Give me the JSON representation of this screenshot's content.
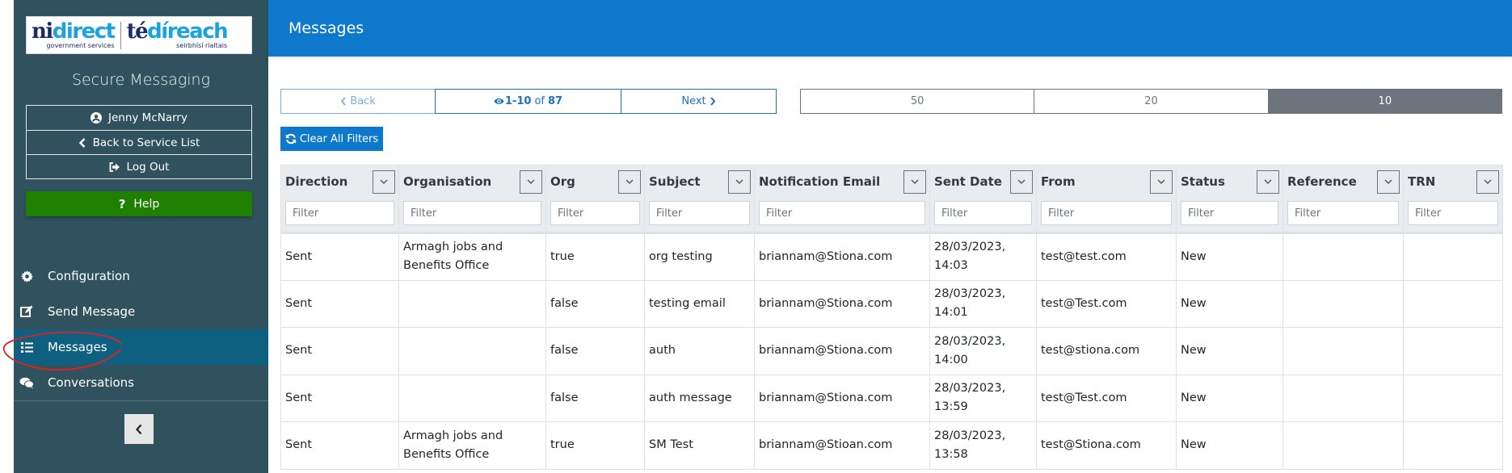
{
  "logo": {
    "left_word_dark": "ni",
    "left_word_light": "direct",
    "left_sub": "government services",
    "right_word_dark": "té",
    "right_word_light": "díreach",
    "right_sub": "seirbhísí rialtais"
  },
  "app_title": "Secure Messaging",
  "user_menu": {
    "user_name": "Jenny McNarry",
    "back_label": "Back to Service List",
    "logout_label": "Log Out"
  },
  "help_label": "Help",
  "nav": {
    "items": [
      {
        "label": "Configuration",
        "icon": "gear-icon"
      },
      {
        "label": "Send Message",
        "icon": "edit-icon"
      },
      {
        "label": "Messages",
        "icon": "list-icon",
        "active": true
      },
      {
        "label": "Conversations",
        "icon": "comments-icon"
      }
    ]
  },
  "header": {
    "title": "Messages"
  },
  "pager": {
    "back_label": "Back",
    "range": "1-10",
    "of_label": "of",
    "total": "87",
    "next_label": "Next"
  },
  "page_sizes": {
    "options": [
      "50",
      "20",
      "10"
    ],
    "selected": "10"
  },
  "clear_filters_label": "Clear All Filters",
  "colors": {
    "sidebar_bg": "#2f525e",
    "active_nav": "#0f5f80",
    "header_bg": "#0d78cc",
    "help_green": "#1f8000",
    "page_size_active": "#6c757d"
  },
  "table": {
    "filter_placeholder": "Filter",
    "columns": [
      "Direction",
      "Organisation",
      "Org",
      "Subject",
      "Notification Email",
      "Sent Date",
      "From",
      "Status",
      "Reference",
      "TRN"
    ],
    "rows": [
      [
        "Sent",
        "Armagh jobs and Benefits Office",
        "true",
        "org testing",
        "briannam@Stiona.com",
        "28/03/2023, 14:03",
        "test@test.com",
        "New",
        "",
        ""
      ],
      [
        "Sent",
        "",
        "false",
        "testing email",
        "briannam@Stiona.com",
        "28/03/2023, 14:01",
        "test@Test.com",
        "New",
        "",
        ""
      ],
      [
        "Sent",
        "",
        "false",
        "auth",
        "briannam@Stiona.com",
        "28/03/2023, 14:00",
        "test@stiona.com",
        "New",
        "",
        ""
      ],
      [
        "Sent",
        "",
        "false",
        "auth message",
        "briannam@Stiona.com",
        "28/03/2023, 13:59",
        "test@Test.com",
        "New",
        "",
        ""
      ],
      [
        "Sent",
        "Armagh jobs and Benefits Office",
        "true",
        "SM Test",
        "briannam@Stioan.com",
        "28/03/2023, 13:58",
        "test@Stiona.com",
        "New",
        "",
        ""
      ]
    ]
  }
}
